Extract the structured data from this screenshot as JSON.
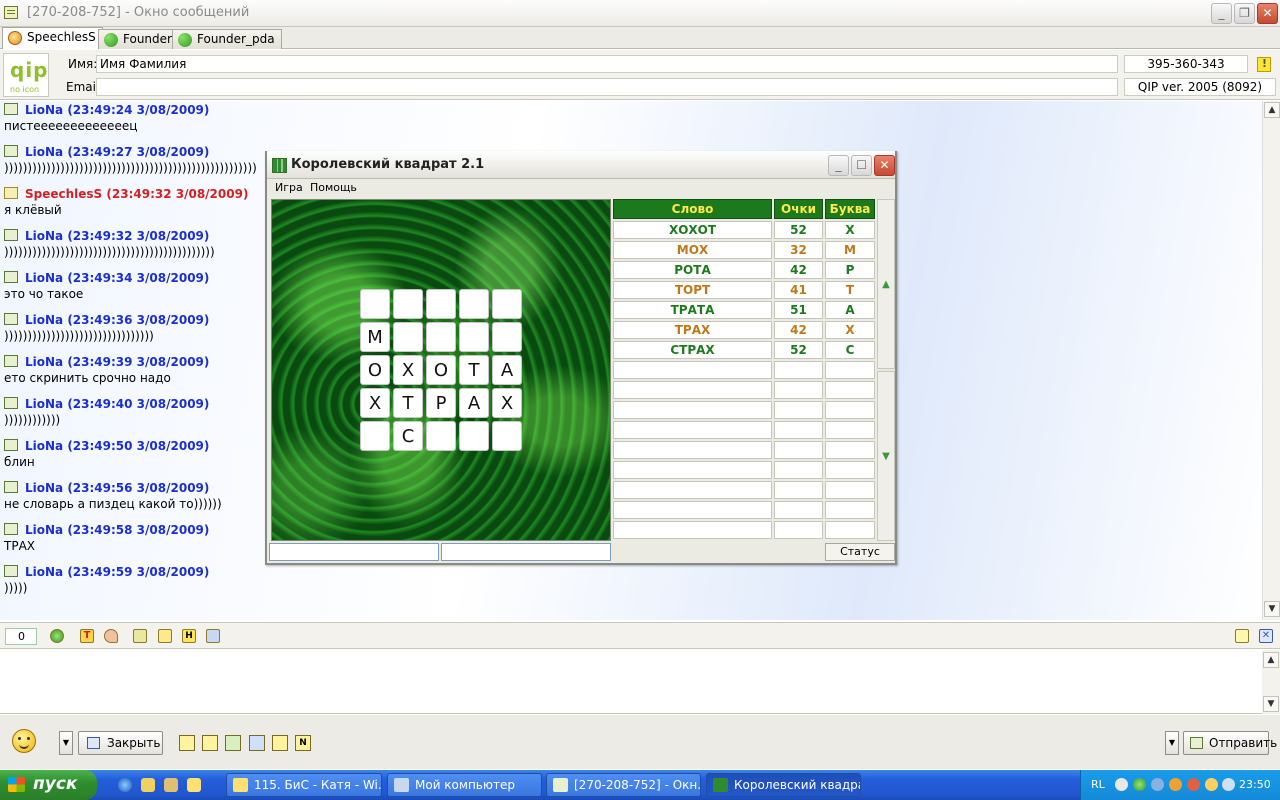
{
  "window": {
    "title": "[270-208-752] - Окно сообщений"
  },
  "tabs": [
    {
      "label": "SpeechlesS",
      "active": true
    },
    {
      "label": "Founder",
      "active": false
    },
    {
      "label": "Founder_pda",
      "active": false
    }
  ],
  "header": {
    "logo_text": "qip",
    "logo_subtext": "no icon",
    "name_label": "Имя:",
    "name_value": "Имя  Фамилия",
    "email_label": "Email:",
    "email_value": "",
    "uin": "395-360-343",
    "client": "QIP ver. 2005 (8092)"
  },
  "messages": [
    {
      "author": "LioNa (23:49:24 3/08/2009)",
      "text": "пистееееееееееееец",
      "own": false
    },
    {
      "author": "LioNa (23:49:27 3/08/2009)",
      "text": "))))))))))))))))))))))))))))))))))))))))))))))))))))))",
      "own": false
    },
    {
      "author": "SpeechlesS (23:49:32 3/08/2009)",
      "text": "я клёвый",
      "own": true
    },
    {
      "author": "LioNa (23:49:32 3/08/2009)",
      "text": ")))))))))))))))))))))))))))))))))))))))))))))",
      "own": false
    },
    {
      "author": "LioNa (23:49:34 3/08/2009)",
      "text": "это чо такое",
      "own": false
    },
    {
      "author": "LioNa (23:49:36 3/08/2009)",
      "text": "))))))))))))))))))))))))))))))))",
      "own": false
    },
    {
      "author": "LioNa (23:49:39 3/08/2009)",
      "text": "ето скринить срочно надо",
      "own": false
    },
    {
      "author": "LioNa (23:49:40 3/08/2009)",
      "text": "))))))))))))",
      "own": false
    },
    {
      "author": "LioNa (23:49:50 3/08/2009)",
      "text": "блин",
      "own": false
    },
    {
      "author": "LioNa (23:49:56 3/08/2009)",
      "text": "не словарь а пиздец какой то))))))",
      "own": false
    },
    {
      "author": "LioNa (23:49:58 3/08/2009)",
      "text": "ТРАХ",
      "own": false
    },
    {
      "author": "LioNa (23:49:59 3/08/2009)",
      "text": ")))))",
      "own": false
    }
  ],
  "game": {
    "title": "Королевский квадрат 2.1",
    "menu": [
      "Игра",
      "Помощь"
    ],
    "grid": [
      [
        "",
        "",
        "",
        "",
        ""
      ],
      [
        "М",
        "",
        "",
        "",
        ""
      ],
      [
        "О",
        "Х",
        "О",
        "Т",
        "А"
      ],
      [
        "Х",
        "Т",
        "Р",
        "А",
        "Х"
      ],
      [
        "",
        "С",
        "",
        "",
        ""
      ]
    ],
    "columns": [
      "Слово",
      "Очки",
      "Буква"
    ],
    "words": [
      {
        "word": "ХОХОТ",
        "points": "52",
        "letter": "Х",
        "player": 1
      },
      {
        "word": "МОХ",
        "points": "32",
        "letter": "М",
        "player": 2
      },
      {
        "word": "РОТА",
        "points": "42",
        "letter": "Р",
        "player": 1
      },
      {
        "word": "ТОРТ",
        "points": "41",
        "letter": "Т",
        "player": 2
      },
      {
        "word": "ТРАТА",
        "points": "51",
        "letter": "А",
        "player": 1
      },
      {
        "word": "ТРАХ",
        "points": "42",
        "letter": "Х",
        "player": 2
      },
      {
        "word": "СТРАХ",
        "points": "52",
        "letter": "С",
        "player": 1
      }
    ],
    "empty_rows": 9,
    "status_button": "Статус",
    "colors": {
      "player1": "#1d7a1d",
      "player2": "#c07818",
      "header_bg": "#1c7a1c",
      "header_text": "#ffe94a"
    }
  },
  "input_bar": {
    "counter": "0"
  },
  "actions": {
    "close_label": "Закрыть",
    "send_label": "Отправить",
    "quick_icons": [
      "N"
    ]
  },
  "taskbar": {
    "start_label": "пуск",
    "tasks": [
      {
        "label": "115. БиС - Катя - Wi...",
        "active": false
      },
      {
        "label": "Мой компьютер",
        "active": false
      },
      {
        "label": "[270-208-752] - Окн...",
        "active": false
      },
      {
        "label": "Королевский квадрат",
        "active": true
      }
    ],
    "lang": "RL",
    "clock": "23:50"
  }
}
